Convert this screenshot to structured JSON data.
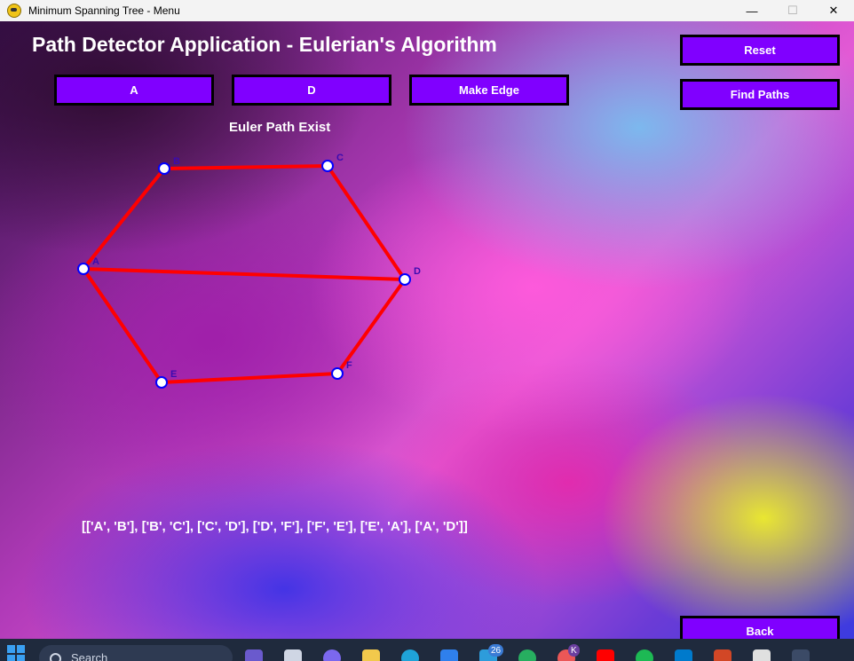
{
  "window": {
    "title": "Minimum Spanning Tree - Menu",
    "minimize": "—",
    "maximize": "☐",
    "close": "✕"
  },
  "app": {
    "title": "Path Detector Application - Eulerian's Algorithm"
  },
  "controls": {
    "source_button": "A",
    "target_button": "D",
    "make_edge": "Make Edge",
    "reset": "Reset",
    "find_paths": "Find Paths",
    "back": "Back"
  },
  "status": "Euler Path Exist",
  "result": "[['A', 'B'], ['B', 'C'], ['C', 'D'], ['D', 'F'], ['F', 'E'], ['E', 'A'], ['A', 'D']]",
  "graph": {
    "nodes": [
      {
        "id": "A",
        "label": "A"
      },
      {
        "id": "B",
        "label": "B"
      },
      {
        "id": "C",
        "label": "C"
      },
      {
        "id": "D",
        "label": "D"
      },
      {
        "id": "E",
        "label": "E"
      },
      {
        "id": "F",
        "label": "F"
      }
    ],
    "edges": [
      [
        "A",
        "B"
      ],
      [
        "B",
        "C"
      ],
      [
        "C",
        "D"
      ],
      [
        "D",
        "F"
      ],
      [
        "F",
        "E"
      ],
      [
        "E",
        "A"
      ],
      [
        "A",
        "D"
      ]
    ],
    "edge_color": "#ff0000",
    "node_color": "#0000ff"
  },
  "colors": {
    "button_bg": "#8000ff",
    "button_border": "#000000"
  },
  "taskbar": {
    "search_placeholder": "Search",
    "badge_count": "26",
    "profile_initial": "K"
  }
}
